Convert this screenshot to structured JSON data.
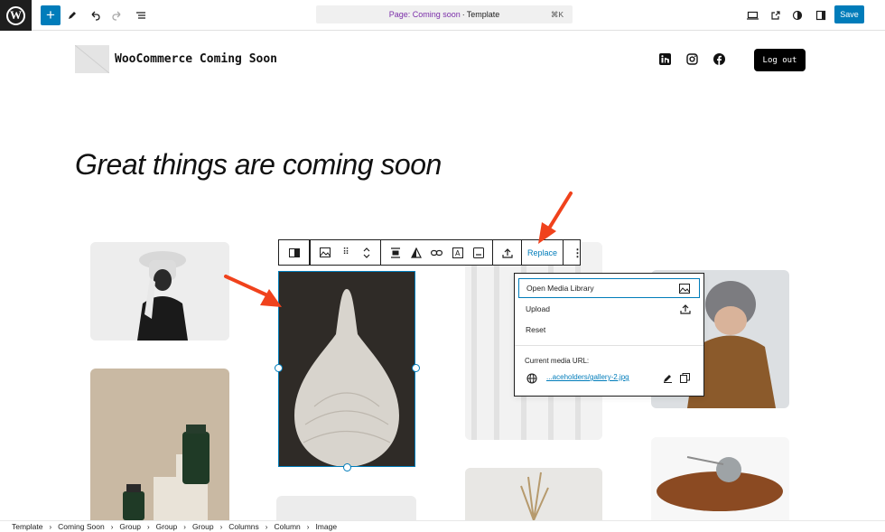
{
  "topbar": {
    "logo": "W",
    "document_title": "Page: Coming soon",
    "document_sep": " · ",
    "document_type": "Template",
    "shortcut": "⌘K",
    "save_label": "Save"
  },
  "site": {
    "title": "WooCommerce Coming Soon",
    "logout_label": "Log out",
    "social": [
      "linkedin-icon",
      "instagram-icon",
      "facebook-icon"
    ]
  },
  "headline": "Great things are coming soon",
  "block_toolbar": {
    "replace_label": "Replace"
  },
  "replace_menu": {
    "open_media_library": "Open Media Library",
    "upload": "Upload",
    "reset": "Reset",
    "current_media_label": "Current media URL:",
    "current_media_url": "...aceholders/gallery-2.jpg"
  },
  "breadcrumbs": [
    "Template",
    "Coming Soon",
    "Group",
    "Group",
    "Group",
    "Columns",
    "Column",
    "Image"
  ],
  "colors": {
    "accent": "#007cba",
    "doc_accent": "#7b2ea9",
    "annotation": "#f0421c"
  }
}
